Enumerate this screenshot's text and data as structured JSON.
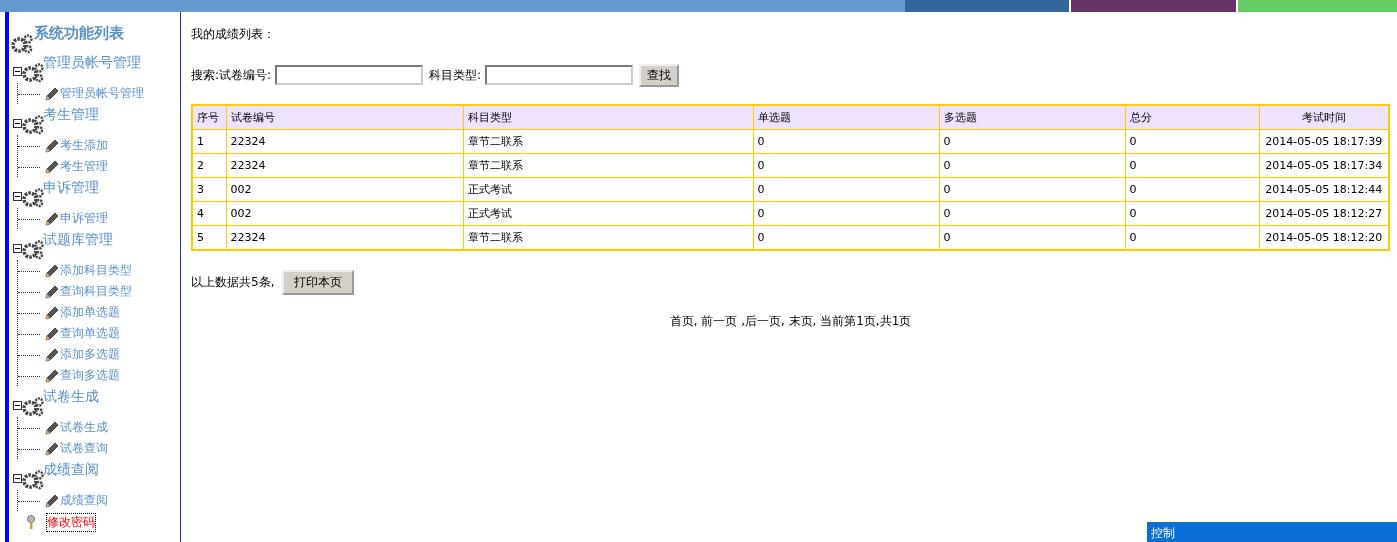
{
  "sidebar": {
    "title": "系统功能列表",
    "groups": [
      {
        "label": "管理员帐号管理",
        "expanded": true,
        "children": [
          {
            "label": "管理员帐号管理"
          }
        ]
      },
      {
        "label": "考生管理",
        "expanded": true,
        "children": [
          {
            "label": "考生添加"
          },
          {
            "label": "考生管理"
          }
        ]
      },
      {
        "label": "申诉管理",
        "expanded": true,
        "children": [
          {
            "label": "申诉管理"
          }
        ]
      },
      {
        "label": "试题库管理",
        "expanded": true,
        "children": [
          {
            "label": "添加科目类型"
          },
          {
            "label": "查询科目类型"
          },
          {
            "label": "添加单选题"
          },
          {
            "label": "查询单选题"
          },
          {
            "label": "添加多选题"
          },
          {
            "label": "查询多选题"
          }
        ]
      },
      {
        "label": "试卷生成",
        "expanded": true,
        "children": [
          {
            "label": "试卷生成"
          },
          {
            "label": "试卷查询"
          }
        ]
      },
      {
        "label": "成绩查阅",
        "expanded": true,
        "children": [
          {
            "label": "成绩查阅"
          }
        ]
      }
    ],
    "footer_item": {
      "label": "修改密码",
      "selected": true
    }
  },
  "main": {
    "heading": "我的成绩列表：",
    "search": {
      "label_1": "搜索:试卷编号:",
      "label_2": "科目类型:",
      "button": "查找"
    },
    "table": {
      "columns": [
        "序号",
        "试卷编号",
        "科目类型",
        "单选题",
        "多选题",
        "总分",
        "考试时间"
      ],
      "rows": [
        [
          "1",
          "22324",
          "章节二联系",
          "0",
          "0",
          "0",
          "2014-05-05 18:17:39"
        ],
        [
          "2",
          "22324",
          "章节二联系",
          "0",
          "0",
          "0",
          "2014-05-05 18:17:34"
        ],
        [
          "3",
          "002",
          "正式考试",
          "0",
          "0",
          "0",
          "2014-05-05 18:12:44"
        ],
        [
          "4",
          "002",
          "正式考试",
          "0",
          "0",
          "0",
          "2014-05-05 18:12:27"
        ],
        [
          "5",
          "22324",
          "章节二联系",
          "0",
          "0",
          "0",
          "2014-05-05 18:12:20"
        ]
      ]
    },
    "summary": "以上数据共5条,",
    "print_button": "打印本页",
    "pagination": "首页, 前一页 ,后一页, 末页, 当前第1页,共1页"
  },
  "control_panel": {
    "title": "控制"
  }
}
